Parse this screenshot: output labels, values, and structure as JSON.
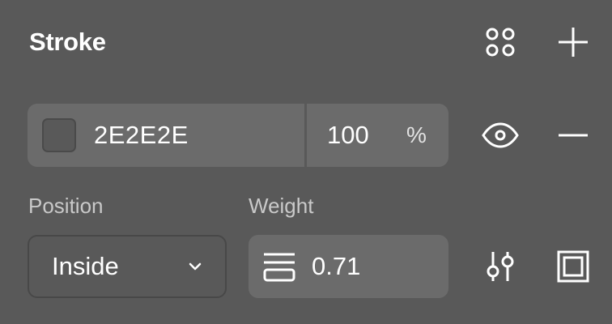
{
  "stroke": {
    "title": "Stroke",
    "color": {
      "hex": "2E2E2E",
      "opacity": "100",
      "opacity_unit": "%",
      "swatch_color": "#595959"
    },
    "position": {
      "label": "Position",
      "value": "Inside"
    },
    "weight": {
      "label": "Weight",
      "value": "0.71"
    },
    "icons": {
      "styles": "four-dots-icon",
      "add": "plus-icon",
      "visibility": "eye-icon",
      "remove": "minus-icon",
      "dropdown": "chevron-down-icon",
      "weight": "stroke-weight-icon",
      "settings": "sliders-icon",
      "border_style": "inside-border-icon"
    }
  }
}
